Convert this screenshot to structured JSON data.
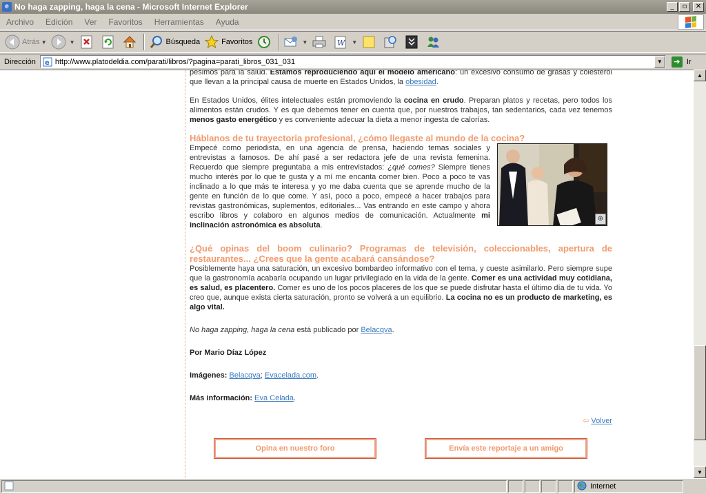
{
  "window": {
    "title": "No haga zapping, haga la cena - Microsoft Internet Explorer",
    "buttons": {
      "minimize": "_",
      "maximize": "▫",
      "close": "✕"
    }
  },
  "menu": [
    "Archivo",
    "Edición",
    "Ver",
    "Favoritos",
    "Herramientas",
    "Ayuda"
  ],
  "toolbar": {
    "back": "Atrás",
    "search": "Búsqueda",
    "favorites": "Favoritos",
    "icons": [
      "back-icon",
      "forward-icon",
      "stop-icon",
      "refresh-icon",
      "home-icon",
      "search-icon",
      "favorites-star-icon",
      "history-icon",
      "mail-icon",
      "print-icon",
      "edit-icon",
      "discuss-icon",
      "research-icon",
      "media-icon",
      "messenger-icon"
    ]
  },
  "address": {
    "label": "Dirección",
    "url": "http://www.platodeldia.com/parati/libros/?pagina=parati_libros_031_031",
    "go": "Ir"
  },
  "article": {
    "p0_a": "pésimos para la salud. ",
    "p0_b": "Estamos reproduciendo aquí el modelo americano",
    "p0_c": ": un excesivo consumo de grasas y colesterol que llevan a la principal causa de muerte en Estados Unidos, la ",
    "p0_link": "obesidad",
    "p0_d": ".",
    "p1_a": "En Estados Unidos, élites intelectuales están promoviendo la ",
    "p1_b": "cocina en crudo",
    "p1_c": ". Preparan platos y recetas, pero todos los alimentos están crudos. Y es que debemos tener en cuenta que, por nuestros trabajos, tan sedentarios, cada vez tenemos ",
    "p1_d": "menos gasto energético",
    "p1_e": " y es conveniente adecuar la dieta a menor ingesta de calorías.",
    "h1": "Háblanos de tu trayectoria profesional, ¿cómo llegaste al mundo de la cocina?",
    "p2_a": "Empecé como periodista, en una agencia de prensa, haciendo temas sociales y entrevistas a famosos. De ahí pasé a ser redactora jefe de una revista femenina. Recuerdo que siempre preguntaba a mis entrevistados: ",
    "p2_i": "¿qué comes?",
    "p2_b": " Siempre tienes mucho interés por lo que te gusta y a mí me encanta comer bien. Poco a poco te vas inclinado a lo que más te interesa y yo me daba cuenta que se aprende mucho de la gente en función de lo que come. Y así, poco a poco, empecé a hacer trabajos para revistas gastronómicas, suplementos, editoriales... Vas entrando en este campo y ahora escribo libros y colaboro en algunos medios de comunicación. Actualmente ",
    "p2_c": "mi inclinación astronómica es absoluta",
    "p2_d": ".",
    "h2": "¿Qué opinas del boom culinario? Programas de televisión, coleccionables, apertura de restaurantes... ¿Crees que la gente acabará cansándose?",
    "p3_a": "Posiblemente haya una saturación, un excesivo bombardeo informativo con el tema, y cueste asimilarlo. Pero siempre supe que la gastronomía acabaría ocupando un lugar privilegiado en la vida de la gente. ",
    "p3_b": "Comer es una actividad muy cotidiana, es salud, es placentero.",
    "p3_c": " Comer es uno de los pocos placeres de los que se puede disfrutar hasta el último día de tu vida. Yo creo que, aunque exista cierta saturación, pronto se volverá a un equilibrio. ",
    "p3_d": "La cocina no es un producto de marketing, es algo vital.",
    "pub_i": "No haga zapping, haga la cena",
    "pub_a": " está publicado por ",
    "pub_link": "Belacqva",
    "pub_b": ".",
    "author": "Por Mario Díaz López",
    "img_label": "Imágenes:",
    "img_link1": "Belacqva",
    "img_sep": "; ",
    "img_link2": "Evacelada.com",
    "img_end": ".",
    "info_label": "Más información:",
    "info_link": "Eva Celada",
    "info_end": ".",
    "volver": "Volver",
    "btn_foro": "Opina en nuestro foro",
    "btn_amigo": "Envía este reportaje a un amigo"
  },
  "status": {
    "zone": "Internet"
  }
}
